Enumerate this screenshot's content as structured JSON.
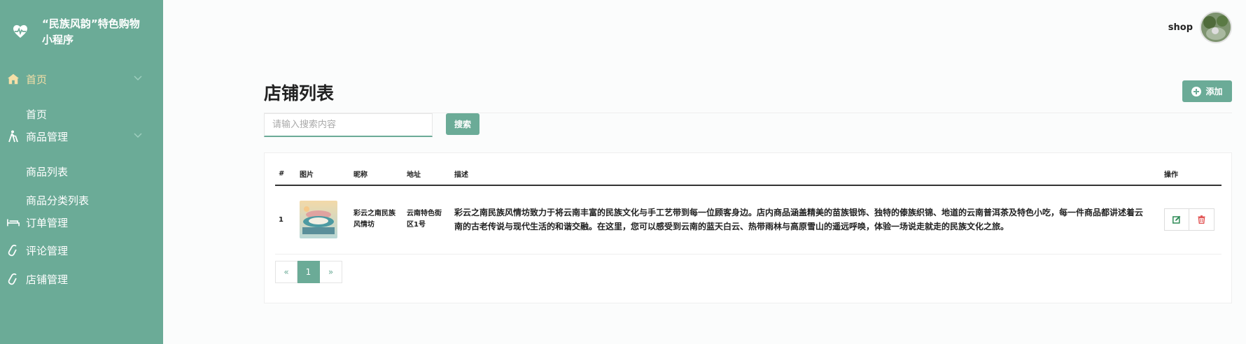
{
  "sidebar": {
    "brand_title": "“民族风韵”特色购物小程序",
    "brand_icon": "heart-pulse-icon",
    "items": [
      {
        "label": "首页",
        "icon": "home-icon",
        "active": true
      },
      {
        "label": "首页",
        "sub": true
      },
      {
        "label": "商品管理",
        "icon": "walking-icon"
      },
      {
        "label": "商品列表",
        "sub": true
      },
      {
        "label": "商品分类列表",
        "sub": true
      },
      {
        "label": "订单管理",
        "icon": "bed-icon"
      },
      {
        "label": "评论管理",
        "icon": "paperclip-icon"
      },
      {
        "label": "店铺管理",
        "icon": "paperclip-icon"
      }
    ]
  },
  "user": {
    "name": "shop"
  },
  "page": {
    "title": "店铺列表",
    "add_label": "添加",
    "search_placeholder": "请输入搜索内容",
    "search_label": "搜索"
  },
  "table": {
    "headers": [
      "#",
      "图片",
      "昵称",
      "地址",
      "描述",
      "操作"
    ],
    "rows": [
      {
        "id": "1",
        "nickname": "彩云之南民族风情坊",
        "address": "云南特色街区1号",
        "description": "彩云之南民族风情坊致力于将云南丰富的民族文化与手工艺带到每一位顾客身边。店内商品涵盖精美的苗族银饰、独特的傣族织锦、地道的云南普洱茶及特色小吃，每一件商品都讲述着云南的古老传说与现代生活的和谐交融。在这里，您可以感受到云南的蓝天白云、热带雨林与高原雪山的遥远呼唤，体验一场说走就走的民族文化之旅。"
      }
    ]
  },
  "pagination": {
    "prev": "«",
    "current": "1",
    "next": "»"
  },
  "colors": {
    "accent": "#6bab97",
    "active_text": "#f6dfa7",
    "edit": "#2e8b57",
    "delete": "#e04b4b"
  }
}
